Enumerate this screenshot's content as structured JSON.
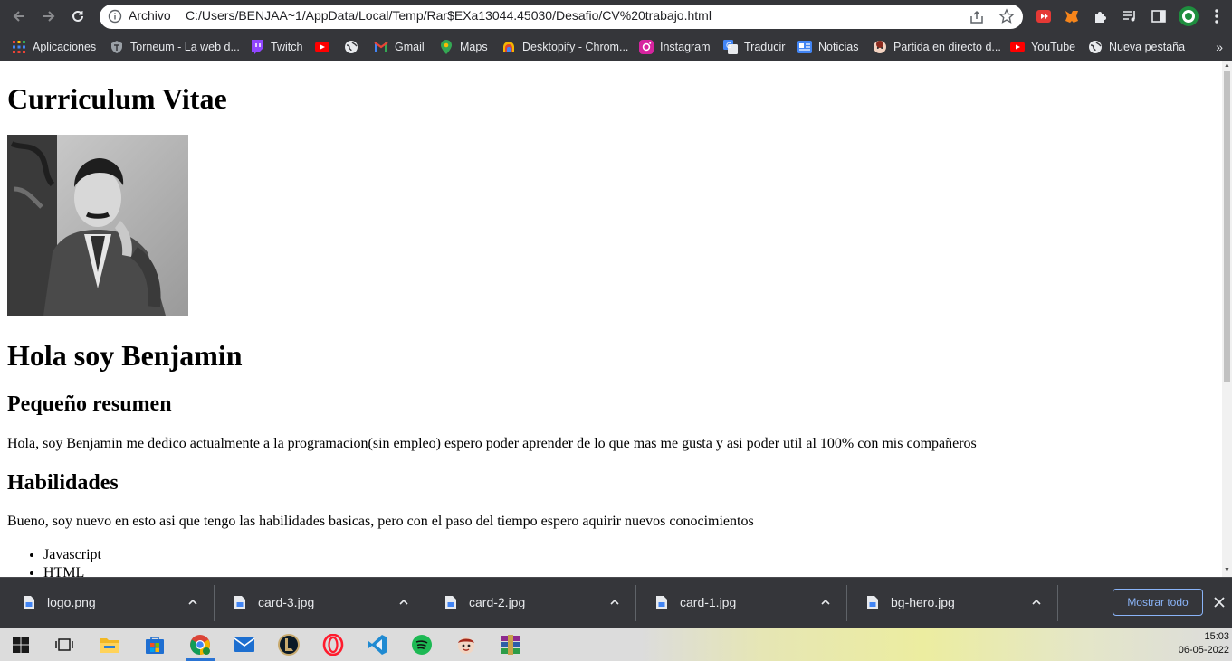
{
  "browser": {
    "omnibox": {
      "chip": "Archivo",
      "url": "C:/Users/BENJAA~1/AppData/Local/Temp/Rar$EXa13044.45030/Desafio/CV%20trabajo.html"
    },
    "bookmarks": [
      {
        "label": "Aplicaciones",
        "icon": "apps-grid-icon"
      },
      {
        "label": "Torneum - La web d...",
        "icon": "torneum-icon"
      },
      {
        "label": "Twitch",
        "icon": "twitch-icon"
      },
      {
        "label": "",
        "icon": "youtube-icon"
      },
      {
        "label": "",
        "icon": "globe-icon"
      },
      {
        "label": "Gmail",
        "icon": "gmail-icon"
      },
      {
        "label": "Maps",
        "icon": "maps-icon"
      },
      {
        "label": "Desktopify - Chrom...",
        "icon": "desktopify-icon"
      },
      {
        "label": "Instagram",
        "icon": "instagram-icon"
      },
      {
        "label": "Traducir",
        "icon": "translate-icon"
      },
      {
        "label": "Noticias",
        "icon": "news-icon"
      },
      {
        "label": "Partida en directo d...",
        "icon": "game-icon"
      },
      {
        "label": "YouTube",
        "icon": "youtube-icon"
      },
      {
        "label": "Nueva pestaña",
        "icon": "globe-icon"
      }
    ],
    "more_glyph": "»"
  },
  "page": {
    "title": "Curriculum Vitae",
    "greeting": "Hola soy Benjamin",
    "summary_heading": "Pequeño resumen",
    "summary_text": "Hola, soy Benjamin me dedico actualmente a la programacion(sin empleo) espero poder aprender de lo que mas me gusta y asi poder util al 100% con mis compañeros",
    "skills_heading": "Habilidades",
    "skills_text": "Bueno, soy nuevo en esto asi que tengo las habilidades basicas, pero con el paso del tiempo espero aquirir nuevos conocimientos",
    "skills": [
      "Javascript",
      "HTML"
    ]
  },
  "downloads": {
    "items": [
      {
        "name": "logo.png"
      },
      {
        "name": "card-3.jpg"
      },
      {
        "name": "card-2.jpg"
      },
      {
        "name": "card-1.jpg"
      },
      {
        "name": "bg-hero.jpg"
      }
    ],
    "show_all_label": "Mostrar todo"
  },
  "taskbar": {
    "time": "15:03",
    "date": "06-05-2022",
    "apps": [
      "windows-start-icon",
      "task-view-icon",
      "file-explorer-icon",
      "microsoft-store-icon",
      "chrome-icon",
      "mail-icon",
      "league-of-legends-icon",
      "opera-gx-icon",
      "vscode-icon",
      "spotify-icon",
      "game-app-icon",
      "winrar-icon"
    ]
  },
  "colors": {
    "chrome_dark": "#35363a",
    "accent_blue": "#8ab4f8",
    "taskbar_active": "#2a74d4"
  }
}
